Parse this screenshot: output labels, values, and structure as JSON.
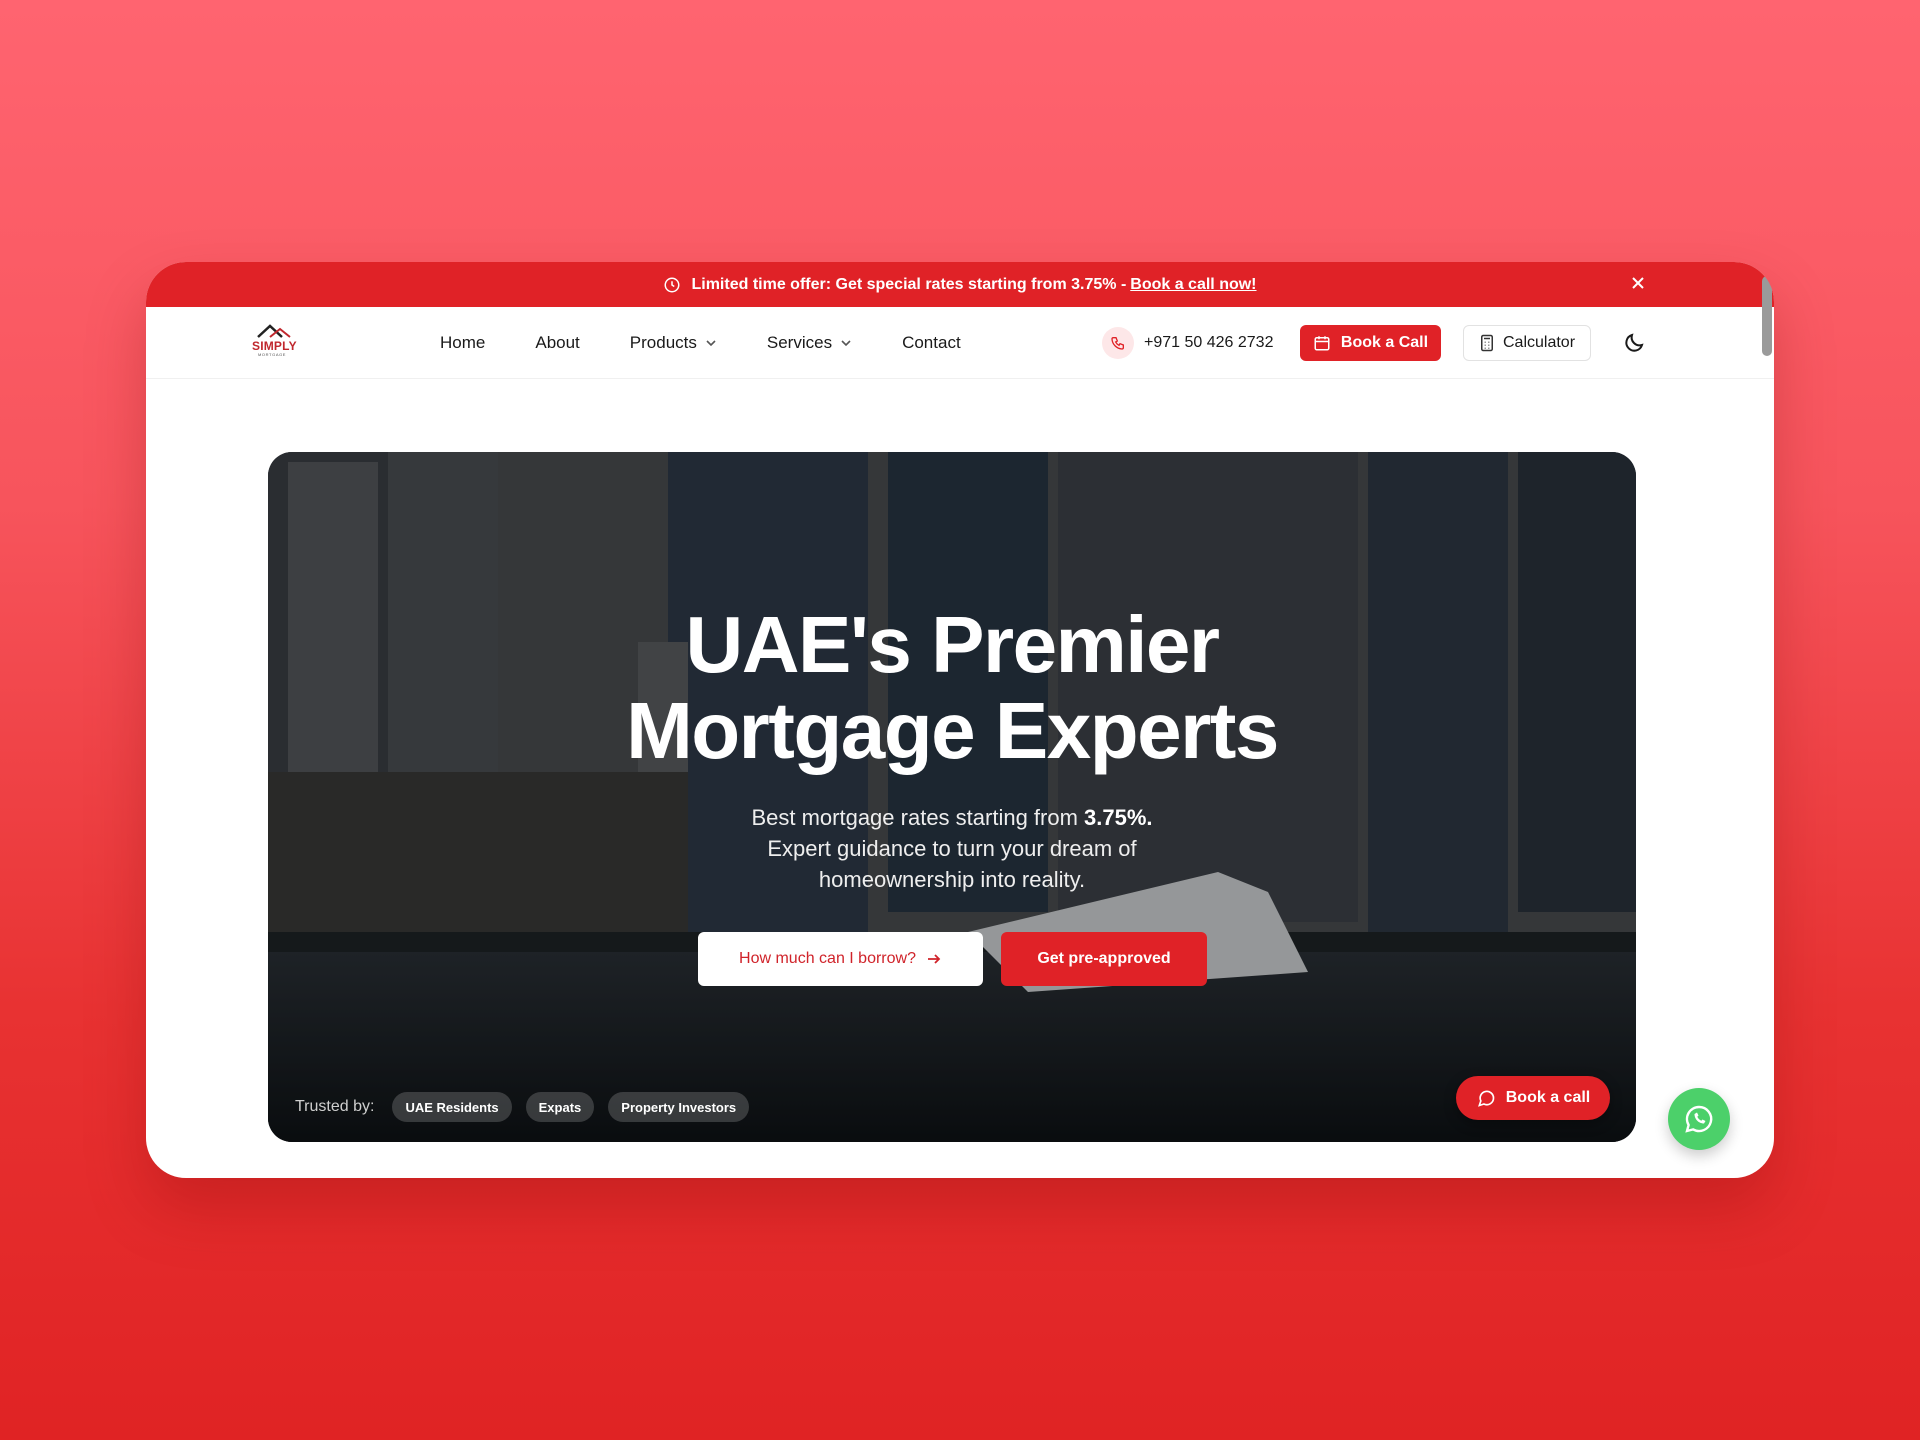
{
  "promo": {
    "text": "Limited time offer: Get special rates starting from 3.75% -",
    "link": "Book a call now!"
  },
  "logo": {
    "word": "SIMPLY",
    "sub": "MORTGAGE"
  },
  "nav": {
    "items": [
      {
        "label": "Home"
      },
      {
        "label": "About"
      },
      {
        "label": "Products"
      },
      {
        "label": "Services"
      },
      {
        "label": "Contact"
      }
    ],
    "phone": "+971 50 426 2732",
    "book_call": "Book a Call",
    "calculator": "Calculator"
  },
  "hero": {
    "title_line1": "UAE's Premier",
    "title_line2": "Mortgage Experts",
    "sub_prefix": "Best mortgage rates starting from",
    "sub_rate": "3.75%.",
    "sub_rest": "Expert guidance to turn your dream of homeownership into reality.",
    "btn_borrow": "How much can I borrow?",
    "btn_preapproved": "Get pre-approved",
    "trusted_label": "Trusted by:",
    "trusted": [
      "UAE Residents",
      "Expats",
      "Property Investors"
    ],
    "float_call": "Book a call"
  },
  "colors": {
    "brand_red": "#e02227",
    "whatsapp_green": "#4cd06a"
  },
  "icons": [
    "clock-icon",
    "close-icon",
    "phone-icon",
    "calendar-icon",
    "calculator-icon",
    "moon-icon",
    "arrow-right-icon",
    "chat-icon",
    "whatsapp-icon",
    "chevron-down-icon"
  ]
}
